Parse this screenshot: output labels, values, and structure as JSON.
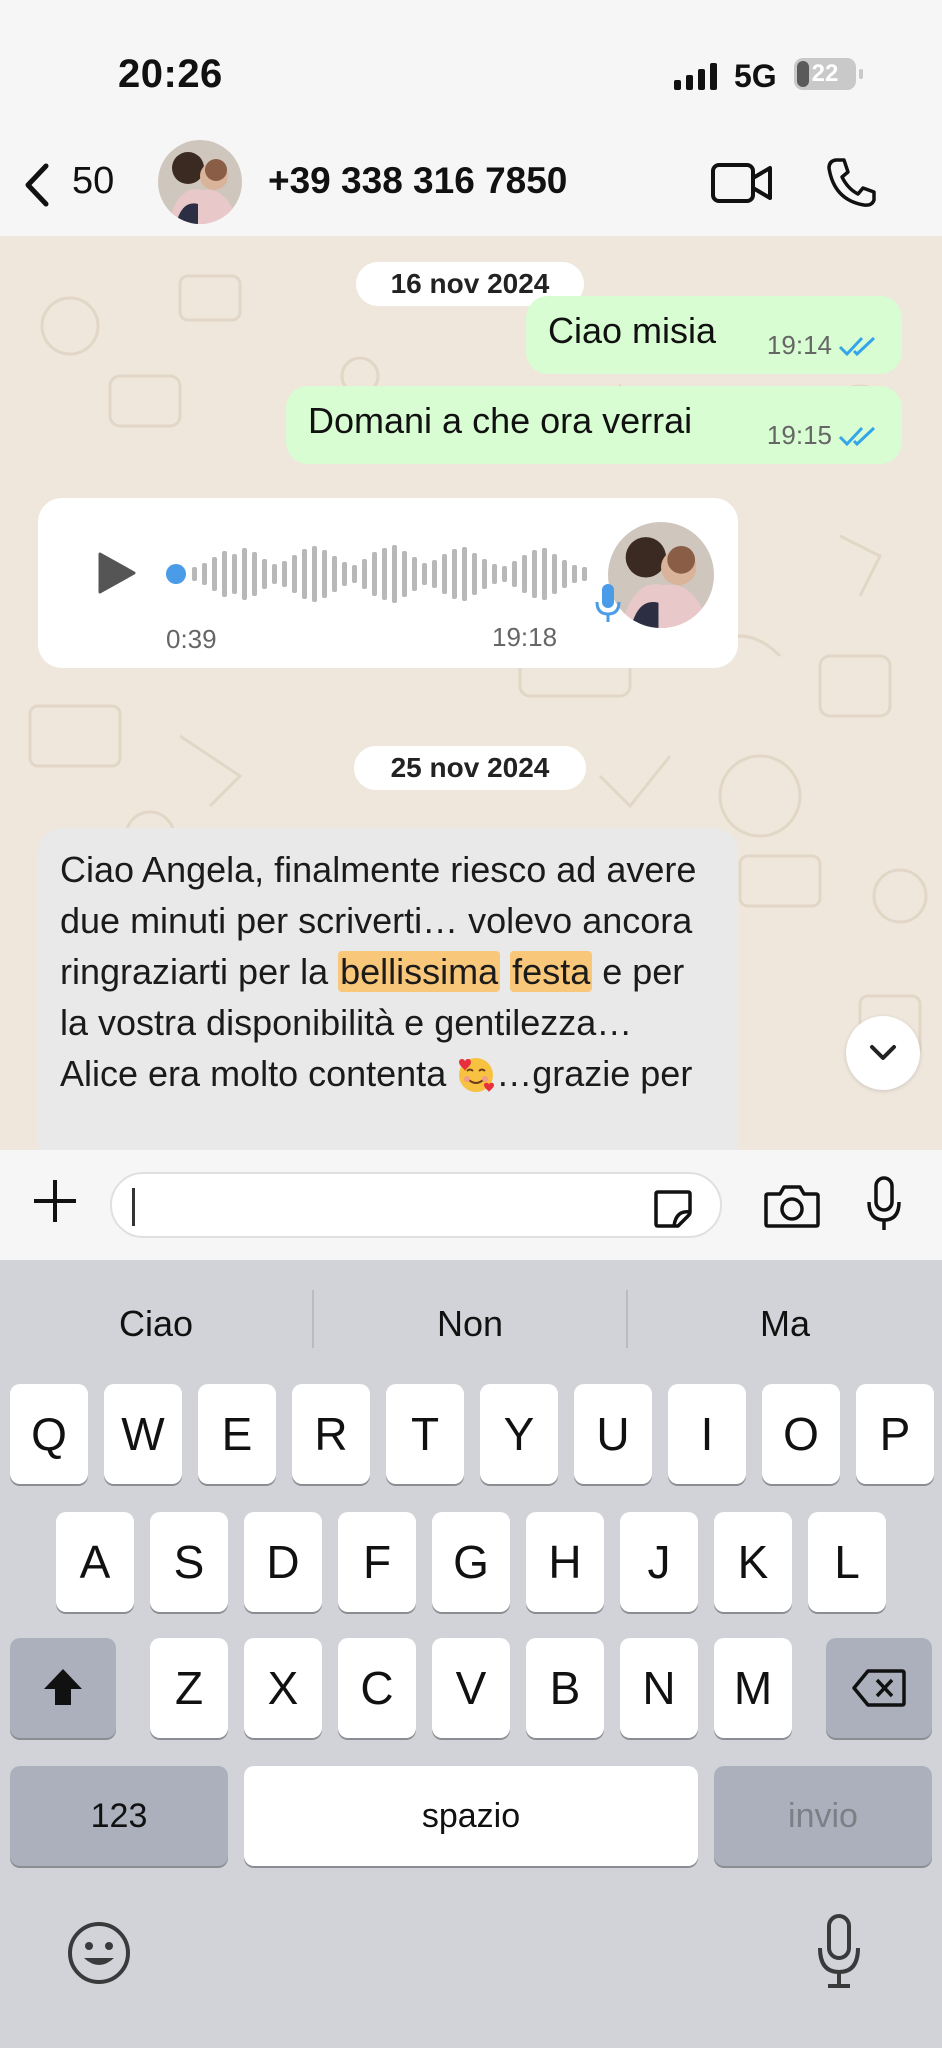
{
  "status_bar": {
    "time": "20:26",
    "network": "5G",
    "battery": "22",
    "battery_level": 0.22
  },
  "header": {
    "back_count": "50",
    "contact": "+39 338 316 7850"
  },
  "chat": {
    "date1": "16 nov 2024",
    "out_messages": [
      {
        "text": "Ciao misia",
        "time": "19:14"
      },
      {
        "text": "Domani a che ora verrai",
        "time": "19:15"
      }
    ],
    "voice": {
      "duration": "0:39",
      "time": "19:18"
    },
    "date2": "25 nov 2024",
    "in_message": {
      "part1": "Ciao Angela, finalmente riesco ad avere due minuti per scriverti… volevo ancora ringraziarti per la ",
      "hl1": "bellissima",
      "hl2": "festa",
      "part2": " e per la vostra disponibilità e gentilezza… Alice era molto contenta ",
      "part3": "…grazie per"
    }
  },
  "input": {
    "placeholder": ""
  },
  "keyboard": {
    "suggestions": [
      "Ciao",
      "Non",
      "Ma"
    ],
    "row1": [
      "Q",
      "W",
      "E",
      "R",
      "T",
      "Y",
      "U",
      "I",
      "O",
      "P"
    ],
    "row2": [
      "A",
      "S",
      "D",
      "F",
      "G",
      "H",
      "J",
      "K",
      "L"
    ],
    "row3": [
      "Z",
      "X",
      "C",
      "V",
      "B",
      "N",
      "M"
    ],
    "numbers_label": "123",
    "space_label": "spazio",
    "return_label": "invio"
  },
  "colors": {
    "outgoing_bubble": "#d8fdd2",
    "incoming_bubble": "#e9e9e9",
    "highlight": "#f8c77a",
    "ticks": "#34a5e8",
    "voice_accent": "#4a9be8"
  }
}
